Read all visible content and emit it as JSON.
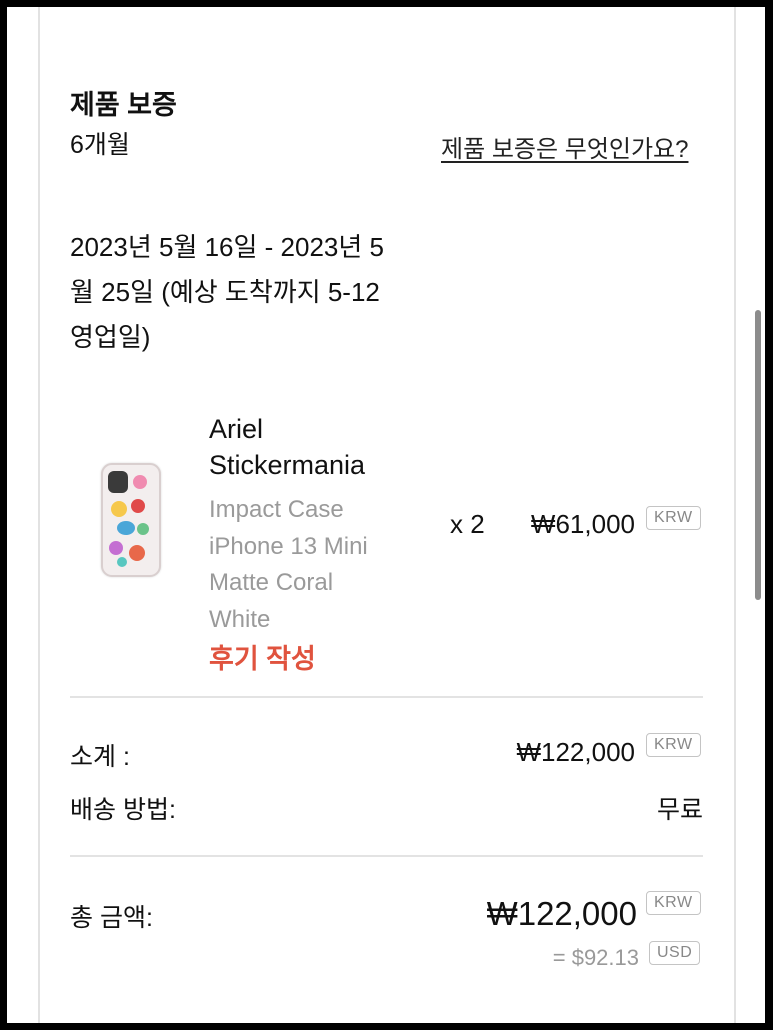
{
  "warranty": {
    "title": "제품 보증",
    "duration": "6개월",
    "link": "제품 보증은 무엇인가요?"
  },
  "delivery_estimate": "2023년 5월 16일 - 2023년 5월 25일 (예상 도착까지 5-12 영업일)",
  "item": {
    "name": "Ariel Stickermania",
    "variant_lines": [
      "Impact Case",
      "iPhone 13 Mini",
      "Matte Coral",
      "White"
    ],
    "review_link": "후기 작성",
    "quantity": "x 2",
    "unit_price": "₩61,000",
    "currency": "KRW"
  },
  "summary": {
    "subtotal_label": "소계 :",
    "subtotal_value": "₩122,000",
    "subtotal_currency": "KRW",
    "shipping_label": "배송 방법:",
    "shipping_value": "무료",
    "total_label": "총 금액:",
    "total_value": "₩122,000",
    "total_currency": "KRW",
    "converted_value": "= $92.13",
    "converted_currency": "USD"
  }
}
